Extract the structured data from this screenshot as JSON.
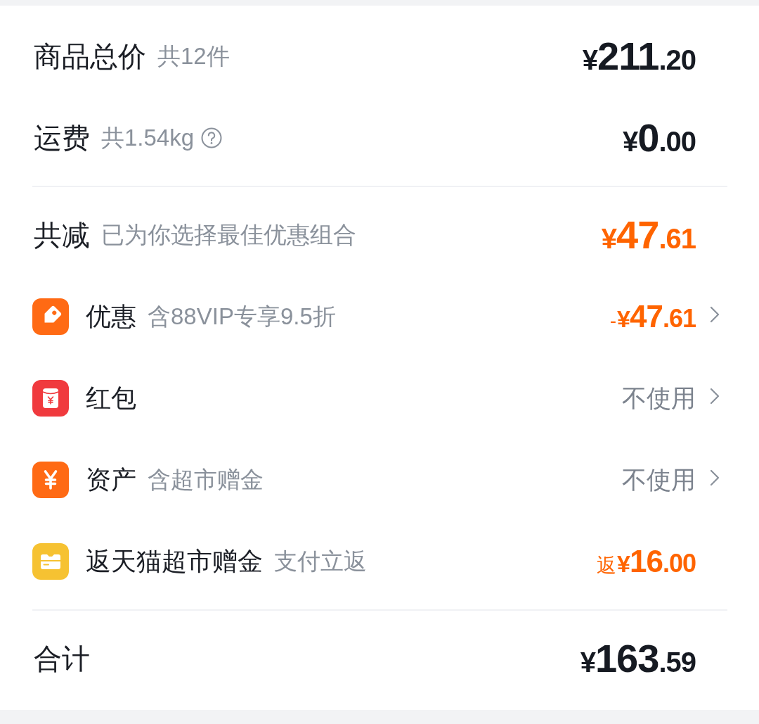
{
  "summary": [
    {
      "label": "商品总价",
      "note": "共12件",
      "help": false,
      "amount": {
        "symbol": "¥",
        "whole": "211",
        "fraction": ".20",
        "highlighted": false
      }
    },
    {
      "label": "运费",
      "note": "共1.54kg",
      "help": true,
      "amount": {
        "symbol": "¥",
        "whole": "0",
        "fraction": ".00",
        "highlighted": false
      }
    }
  ],
  "savings": {
    "label": "共减",
    "note": "已为你选择最佳优惠组合",
    "amount": {
      "symbol": "¥",
      "whole": "47",
      "fraction": ".61",
      "highlighted": true
    }
  },
  "savings_items": [
    {
      "kind": "coupon",
      "label": "优惠",
      "note": "含88VIP专享9.5折",
      "navigable": true,
      "value": {
        "kind": "price",
        "prefix": "-",
        "symbol": "¥",
        "whole": "47",
        "fraction": ".61",
        "highlighted": true
      }
    },
    {
      "kind": "red_packet",
      "label": "红包",
      "navigable": true,
      "value": {
        "kind": "text",
        "text": "不使用"
      }
    },
    {
      "kind": "asset",
      "label": "资产",
      "note": "含超市赠金",
      "navigable": true,
      "value": {
        "kind": "text",
        "text": "不使用"
      }
    },
    {
      "kind": "rebate",
      "label": "返天猫超市赠金",
      "note": "支付立返",
      "navigable": false,
      "value": {
        "kind": "price",
        "prefix": "返",
        "symbol": "¥",
        "whole": "16",
        "fraction": ".00",
        "highlighted": true
      }
    }
  ],
  "total": {
    "label": "合计",
    "amount": {
      "symbol": "¥",
      "whole": "163",
      "fraction": ".59",
      "highlighted": false
    }
  }
}
